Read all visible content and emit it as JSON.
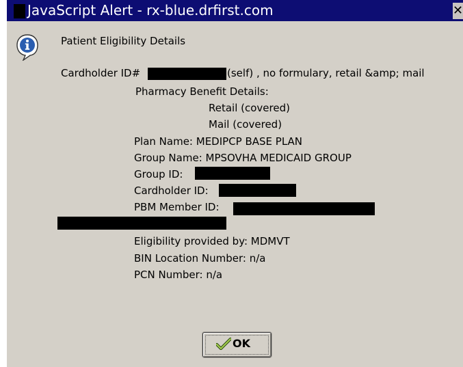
{
  "window": {
    "title": "JavaScript Alert - rx-blue.drfirst.com",
    "close_glyph": "✕"
  },
  "dialog": {
    "icon": "info-icon",
    "heading": "Patient Eligibility Details",
    "cardholder_prefix": "Cardholder ID#",
    "cardholder_suffix": "(self) , no formulary, retail &amp; mail",
    "pharmacy_benefit_label": "Pharmacy Benefit Details:",
    "retail": "Retail (covered)",
    "mail": "Mail (covered)",
    "plan_name": "Plan Name: MEDIPCP BASE PLAN",
    "group_name": "Group Name: MPSOVHA MEDICAID GROUP",
    "group_id_label": "Group ID:",
    "cardholder_id_label": "Cardholder ID:",
    "pbm_member_id_label": "PBM Member ID:",
    "eligibility_provided_by": "Eligibility provided by: MDMVT",
    "bin_location": "BIN Location Number: n/a",
    "pcn_number": "PCN Number: n/a"
  },
  "ok_button": {
    "label": "OK",
    "icon": "checkmark-icon"
  },
  "colors": {
    "titlebar": "#0d0d73",
    "dialog_bg": "#d4d0c8",
    "redaction": "#000000"
  }
}
